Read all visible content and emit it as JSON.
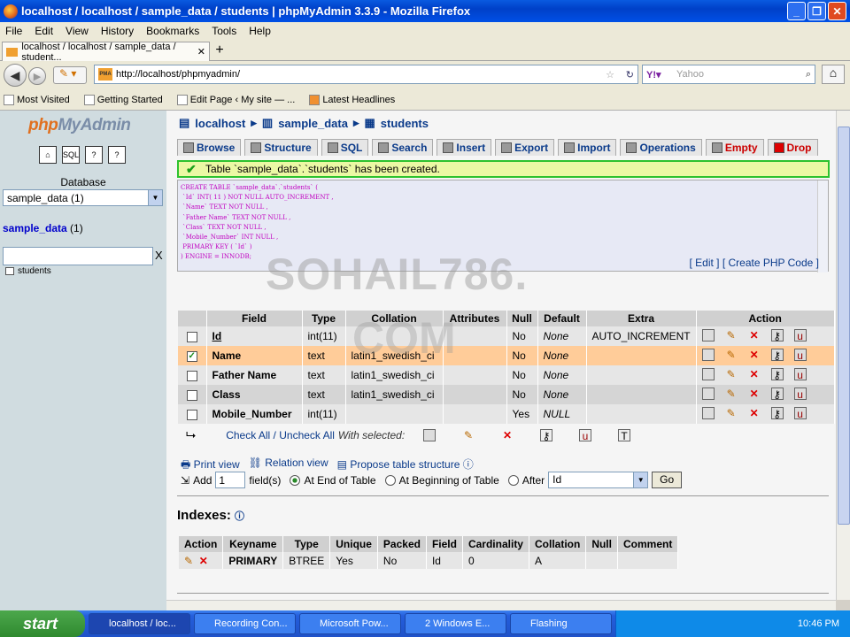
{
  "window": {
    "title": "localhost / localhost / sample_data / students | phpMyAdmin 3.3.9 - Mozilla Firefox"
  },
  "menu": [
    "File",
    "Edit",
    "View",
    "History",
    "Bookmarks",
    "Tools",
    "Help"
  ],
  "browser_tab": {
    "label": "localhost / localhost / sample_data / student..."
  },
  "address": {
    "url": "http://localhost/phpmyadmin/",
    "search_placeholder": "Yahoo"
  },
  "bookmarks": [
    "Most Visited",
    "Getting Started",
    "Edit Page ‹ My site — ...",
    "Latest Headlines"
  ],
  "sidebar": {
    "logo_a": "php",
    "logo_b": "MyAdmin",
    "database_label": "Database",
    "database_selected": "sample_data (1)",
    "db_link": "sample_data",
    "db_count": "(1)",
    "filter_clear": "X",
    "tables": [
      "students"
    ]
  },
  "breadcrumb": {
    "server": "localhost",
    "db": "sample_data",
    "table": "students"
  },
  "tabs": [
    "Browse",
    "Structure",
    "SQL",
    "Search",
    "Insert",
    "Export",
    "Import",
    "Operations",
    "Empty",
    "Drop"
  ],
  "message": "Table `sample_data`.`students` has been created.",
  "sql_code": "CREATE TABLE `sample_data`.`students` (\n `Id` INT( 11 ) NOT NULL AUTO_INCREMENT ,\n `Name` TEXT NOT NULL ,\n `Father Name` TEXT NOT NULL ,\n `Class` TEXT NOT NULL ,\n `Mobile_Number` INT NULL ,\n PRIMARY KEY ( `Id` )\n) ENGINE = INNODB;",
  "sql_links": {
    "edit": "[ Edit ]",
    "php": "[ Create PHP Code ]"
  },
  "watermark": {
    "line1": "SOHAIL786.",
    "line2": "COM"
  },
  "fields_table": {
    "headers": [
      "Field",
      "Type",
      "Collation",
      "Attributes",
      "Null",
      "Default",
      "Extra",
      "Action"
    ],
    "rows": [
      {
        "field": "Id",
        "type": "int(11)",
        "collation": "",
        "attributes": "",
        "null": "No",
        "default": "None",
        "extra": "AUTO_INCREMENT",
        "checked": false
      },
      {
        "field": "Name",
        "type": "text",
        "collation": "latin1_swedish_ci",
        "attributes": "",
        "null": "No",
        "default": "None",
        "extra": "",
        "checked": true
      },
      {
        "field": "Father Name",
        "type": "text",
        "collation": "latin1_swedish_ci",
        "attributes": "",
        "null": "No",
        "default": "None",
        "extra": "",
        "checked": false
      },
      {
        "field": "Class",
        "type": "text",
        "collation": "latin1_swedish_ci",
        "attributes": "",
        "null": "No",
        "default": "None",
        "extra": "",
        "checked": false
      },
      {
        "field": "Mobile_Number",
        "type": "int(11)",
        "collation": "",
        "attributes": "",
        "null": "Yes",
        "default": "NULL",
        "extra": "",
        "checked": false
      }
    ]
  },
  "check_all": {
    "text": "Check All / Uncheck All",
    "with_selected": "With selected:"
  },
  "links": [
    "Print view",
    "Relation view",
    "Propose table structure"
  ],
  "add_fields": {
    "label": "Add",
    "count": "1",
    "fields": "field(s)",
    "opt_end": "At End of Table",
    "opt_begin": "At Beginning of Table",
    "opt_after": "After",
    "after_value": "Id",
    "go": "Go"
  },
  "indexes": {
    "title": "Indexes:",
    "headers": [
      "Action",
      "Keyname",
      "Type",
      "Unique",
      "Packed",
      "Field",
      "Cardinality",
      "Collation",
      "Null",
      "Comment"
    ],
    "row": {
      "keyname": "PRIMARY",
      "type": "BTREE",
      "unique": "Yes",
      "packed": "No",
      "field": "Id",
      "cardinality": "0",
      "collation": "A",
      "null": "",
      "comment": ""
    }
  },
  "taskbar": {
    "start": "start",
    "tasks": [
      "localhost / loc...",
      "Recording Con...",
      "Microsoft Pow...",
      "2 Windows E...",
      "Flashing"
    ],
    "clock": "10:46 PM"
  }
}
